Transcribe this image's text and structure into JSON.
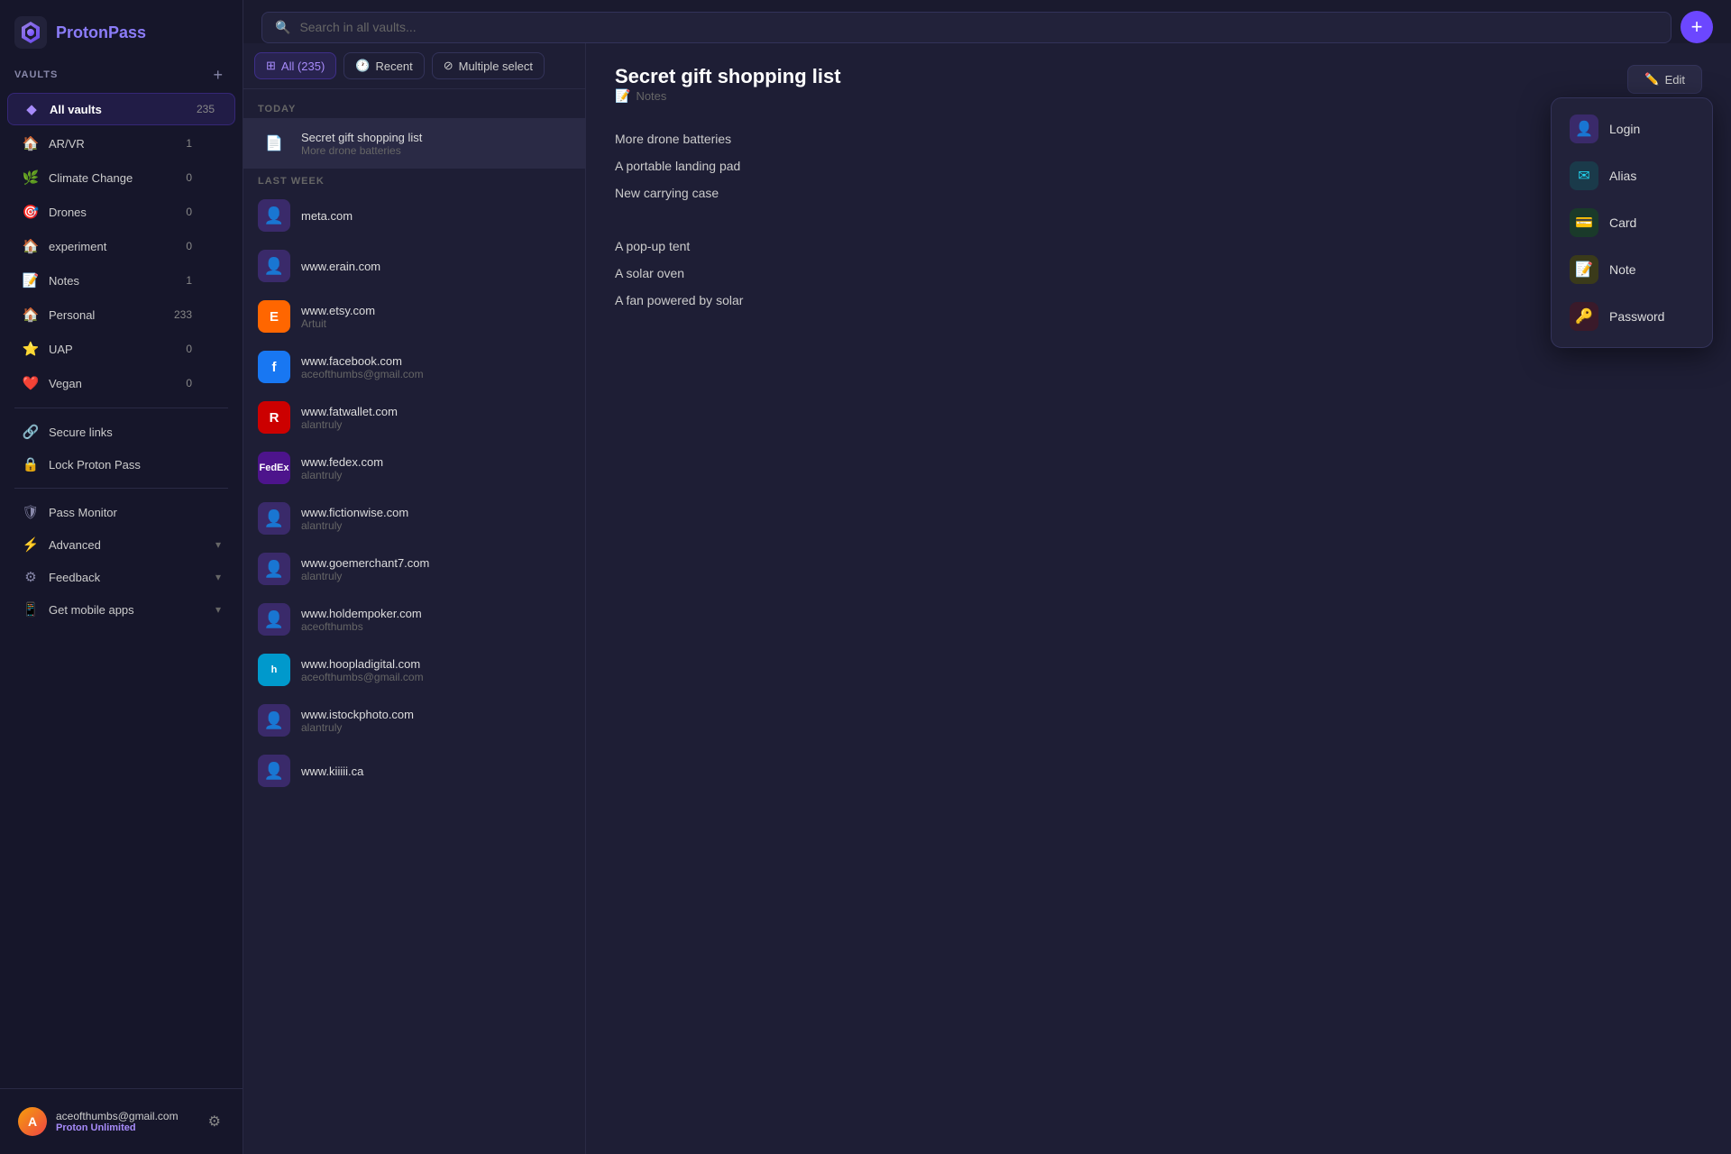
{
  "app": {
    "name": "Proton",
    "name_highlight": "Pass"
  },
  "sidebar": {
    "vaults_label": "Vaults",
    "all_vaults": {
      "label": "All vaults",
      "count": "235"
    },
    "items": [
      {
        "id": "ar-vr",
        "label": "AR/VR",
        "count": "1",
        "icon": "🏠"
      },
      {
        "id": "climate-change",
        "label": "Climate Change",
        "count": "0",
        "icon": "🌿"
      },
      {
        "id": "drones",
        "label": "Drones",
        "count": "0",
        "icon": "🎯"
      },
      {
        "id": "experiment",
        "label": "experiment",
        "count": "0",
        "icon": "🏠"
      },
      {
        "id": "notes",
        "label": "Notes",
        "count": "1",
        "icon": "📝"
      },
      {
        "id": "personal",
        "label": "Personal",
        "count": "233",
        "icon": "🏠"
      },
      {
        "id": "uap",
        "label": "UAP",
        "count": "0",
        "icon": "⭐"
      },
      {
        "id": "vegan",
        "label": "Vegan",
        "count": "0",
        "icon": "❤️"
      },
      {
        "id": "secure-links",
        "label": "Secure links",
        "count": "",
        "icon": "🔗"
      },
      {
        "id": "lock",
        "label": "Lock Proton Pass",
        "count": "",
        "icon": "🔒"
      }
    ],
    "bottom_items": [
      {
        "id": "pass-monitor",
        "label": "Pass Monitor",
        "icon": "🛡"
      },
      {
        "id": "advanced",
        "label": "Advanced",
        "icon": "⚡",
        "expandable": true
      },
      {
        "id": "feedback",
        "label": "Feedback",
        "icon": "⚙",
        "expandable": true
      },
      {
        "id": "mobile-apps",
        "label": "Get mobile apps",
        "icon": "📱",
        "expandable": true
      }
    ],
    "user": {
      "email": "aceofthumbs@gmail.com",
      "plan": "Proton Unlimited",
      "avatar_initial": "A"
    }
  },
  "search": {
    "placeholder": "Search in all vaults..."
  },
  "toolbar": {
    "all_label": "All (235)",
    "recent_label": "Recent",
    "multiple_select_label": "Multiple select"
  },
  "item_list": {
    "today_label": "Today",
    "last_week_label": "Last week",
    "today_items": [
      {
        "id": "secret-gift",
        "title": "Secret gift shopping list",
        "subtitle": "More drone batteries",
        "type": "note",
        "selected": true
      }
    ],
    "last_week_items": [
      {
        "id": "meta",
        "title": "meta.com",
        "subtitle": "",
        "type": "user"
      },
      {
        "id": "erain",
        "title": "www.erain.com",
        "subtitle": "",
        "type": "user"
      },
      {
        "id": "etsy",
        "title": "www.etsy.com",
        "subtitle": "Artuit",
        "type": "etsy",
        "bg": "#ff6600"
      },
      {
        "id": "facebook",
        "title": "www.facebook.com",
        "subtitle": "aceofthumbs@gmail.com",
        "type": "facebook"
      },
      {
        "id": "fatwallet",
        "title": "www.fatwallet.com",
        "subtitle": "alantruly",
        "type": "fatwallet",
        "bg": "#cc0000"
      },
      {
        "id": "fedex",
        "title": "www.fedex.com",
        "subtitle": "alantruly",
        "type": "fedex"
      },
      {
        "id": "fictionwise",
        "title": "www.fictionwise.com",
        "subtitle": "alantruly",
        "type": "user"
      },
      {
        "id": "goemerchant",
        "title": "www.goemerchant7.com",
        "subtitle": "alantruly",
        "type": "user"
      },
      {
        "id": "holdem",
        "title": "www.holdempoker.com",
        "subtitle": "aceofthumbs",
        "type": "user"
      },
      {
        "id": "hoopladigital",
        "title": "www.hoopladigital.com",
        "subtitle": "aceofthumbs@gmail.com",
        "type": "hoopla",
        "bg": "#0099cc"
      },
      {
        "id": "istockphoto",
        "title": "www.istockphoto.com",
        "subtitle": "alantruly",
        "type": "user"
      },
      {
        "id": "kiiiii",
        "title": "www.kiiiii.ca",
        "subtitle": "",
        "type": "user"
      }
    ]
  },
  "detail": {
    "title": "Secret gift shopping list",
    "type_label": "Notes",
    "type_icon": "📝",
    "edit_label": "Edit",
    "content_lines": [
      "More drone batteries",
      "A portable landing pad",
      "New carrying case",
      "",
      "A pop-up tent",
      "A solar oven",
      "A fan powered by solar"
    ]
  },
  "dropdown": {
    "items": [
      {
        "id": "login",
        "label": "Login",
        "icon_type": "login"
      },
      {
        "id": "alias",
        "label": "Alias",
        "icon_type": "alias"
      },
      {
        "id": "card",
        "label": "Card",
        "icon_type": "card"
      },
      {
        "id": "note",
        "label": "Note",
        "icon_type": "note"
      },
      {
        "id": "password",
        "label": "Password",
        "icon_type": "password"
      }
    ]
  }
}
